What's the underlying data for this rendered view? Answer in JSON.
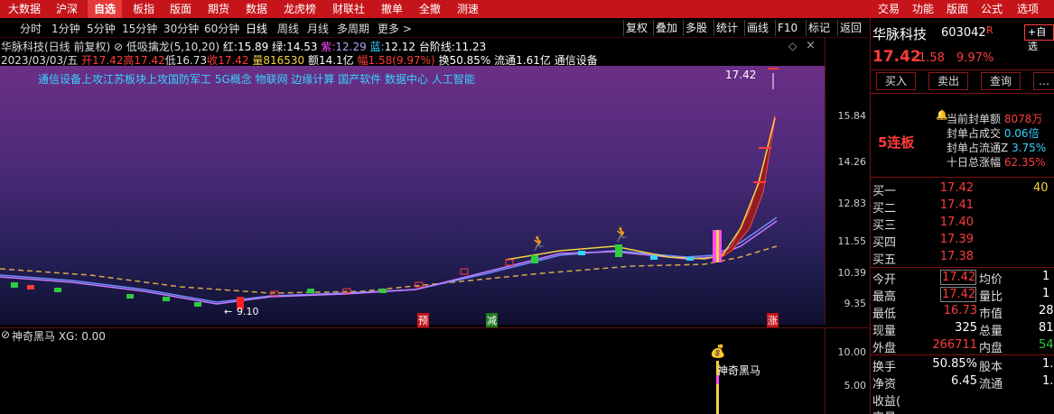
{
  "colors": {
    "menu_bg": "#c5141a",
    "up": "#ff3b3b",
    "down": "#2ecc40",
    "accent_yellow": "#f5d142",
    "cyan": "#37d3ff",
    "magenta": "#ff4bff"
  },
  "top_menu": {
    "left": [
      "大数据",
      "沪深",
      "自选",
      "板指",
      "版面",
      "期货",
      "数据",
      "龙虎榜",
      "财联社",
      "撤单",
      "全撤",
      "测速"
    ],
    "right": [
      "交易",
      "功能",
      "版面",
      "公式",
      "选项"
    ],
    "active_index": 2
  },
  "period_bar": {
    "periods": [
      "分时",
      "1分钟",
      "5分钟",
      "15分钟",
      "30分钟",
      "60分钟",
      "日线",
      "周线",
      "月线",
      "多周期",
      "更多 >"
    ],
    "selected_index": 6,
    "tools": [
      "复权",
      "叠加",
      "多股",
      "统计",
      "画线",
      "F10",
      "标记",
      "返回"
    ]
  },
  "chart_header": {
    "title": "华脉科技(日线 前复权)",
    "indicator_name": "低吸擒龙(5,10,20)",
    "ind_red_label": "红:",
    "ind_red_value": "15.89",
    "ind_green_label": "绿:",
    "ind_green_value": "14.53",
    "ind_purple_label": "紫:",
    "ind_purple_value": "12.29",
    "ind_blue_label": "蓝:",
    "ind_blue_value": "12.12",
    "ind_step_label": "台阶线:",
    "ind_step_value": "11.23",
    "date": "2023/03/03/五",
    "open": "开17.42",
    "high": "高17.42",
    "low": "低16.73",
    "close": "收17.42",
    "volume": "量816530",
    "amount": "额14.1亿",
    "change": "幅1.58(9.97%)",
    "turnover": "换50.85%",
    "float_cap": "流通1.61亿",
    "sector": "通信设备"
  },
  "concept_tags": "通信设备上攻江苏板块上攻国防军工 5G概念 物联网 边缘计算 国产软件 数据中心 人工智能",
  "price_labels": {
    "peak": "17.42",
    "trough": "9.10"
  },
  "y_axis": [
    "15.84",
    "14.26",
    "12.83",
    "11.55",
    "10.39",
    "9.35"
  ],
  "markers": {
    "pre": "预",
    "reduce": "减",
    "rise": "涨"
  },
  "sub_indicator": {
    "title": "神奇黑马 XG: 0.00",
    "signal_label": "神奇黑马",
    "y_axis": [
      "10.00",
      "5.00"
    ]
  },
  "quote_panel": {
    "name": "华脉科技",
    "code": "603042",
    "r_mark": "R",
    "self_select": "+自选",
    "price": "17.42",
    "change": "1.58",
    "change_pct": "9.97%",
    "buttons": [
      "买入",
      "卖出",
      "查询"
    ],
    "streak": "5连板",
    "seal_stats": [
      {
        "label": "当前封单额",
        "value": "8078万"
      },
      {
        "label": "封单占成交",
        "value": "0.06倍"
      },
      {
        "label": "封单占流通Z",
        "value": "3.75%"
      },
      {
        "label": "十日总涨幅",
        "value": "62.35%"
      }
    ],
    "bids": [
      {
        "label": "买一",
        "price": "17.42",
        "vol": "40"
      },
      {
        "label": "买二",
        "price": "17.41",
        "vol": ""
      },
      {
        "label": "买三",
        "price": "17.40",
        "vol": ""
      },
      {
        "label": "买四",
        "price": "17.39",
        "vol": ""
      },
      {
        "label": "买五",
        "price": "17.38",
        "vol": ""
      }
    ],
    "stats": [
      {
        "l1": "今开",
        "v1": "17.42",
        "l2": "均价",
        "v2": "1"
      },
      {
        "l1": "最高",
        "v1": "17.42",
        "l2": "量比",
        "v2": "1"
      },
      {
        "l1": "最低",
        "v1": "16.73",
        "l2": "市值",
        "v2": "28"
      },
      {
        "l1": "现量",
        "v1": "325",
        "l2": "总量",
        "v2": "81("
      },
      {
        "l1": "外盘",
        "v1": "266711",
        "l2": "内盘",
        "v2": "54"
      },
      {
        "l1": "换手",
        "v1": "50.85%",
        "l2": "股本",
        "v2": "1."
      },
      {
        "l1": "净资",
        "v1": "6.45",
        "l2": "流通",
        "v2": "1."
      },
      {
        "l1": "收益(",
        "v1": "",
        "l2": "",
        "v2": ""
      },
      {
        "l1": "交易",
        "v1": "",
        "l2": "",
        "v2": ""
      }
    ]
  }
}
